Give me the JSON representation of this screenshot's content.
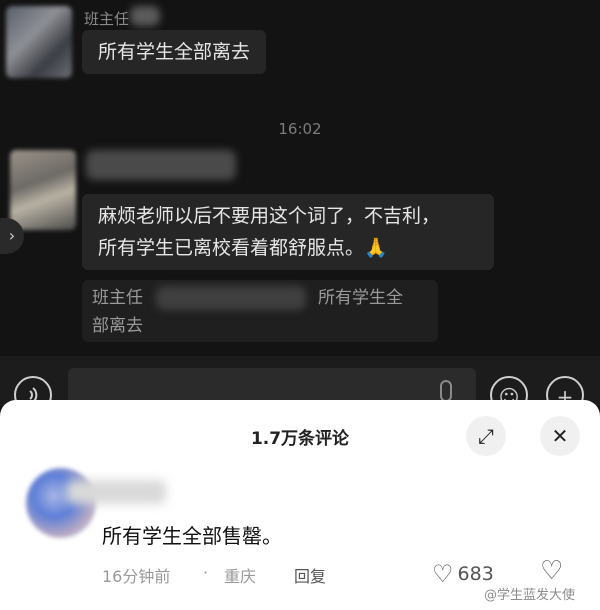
{
  "chat": {
    "msg1": {
      "sender": "班主任",
      "text": "所有学生全部离去"
    },
    "time": "16:02",
    "msg2": {
      "line1": "麻烦老师以后不要用这个词了，不吉利，",
      "line2": "所有学生已离校看着都舒服点。",
      "emoji": "🙏"
    },
    "quote": {
      "sender": "班主任",
      "line1_tail": "所有学生全",
      "line2": "部离去"
    },
    "side_arrow": "›"
  },
  "input_bar": {
    "voice_icon": "voice-icon",
    "emoji_icon": "emoji-icon",
    "plus_icon": "plus-icon"
  },
  "comments_panel": {
    "title": "1.7万条评论",
    "expand_icon": "⤢",
    "close_icon": "✕",
    "comment": {
      "text": "所有学生全部售罄。",
      "time": "16分钟前",
      "separator": "·",
      "location": "重庆",
      "reply": "回复",
      "likes": "683"
    }
  },
  "watermark": "@学生蓝发大使"
}
